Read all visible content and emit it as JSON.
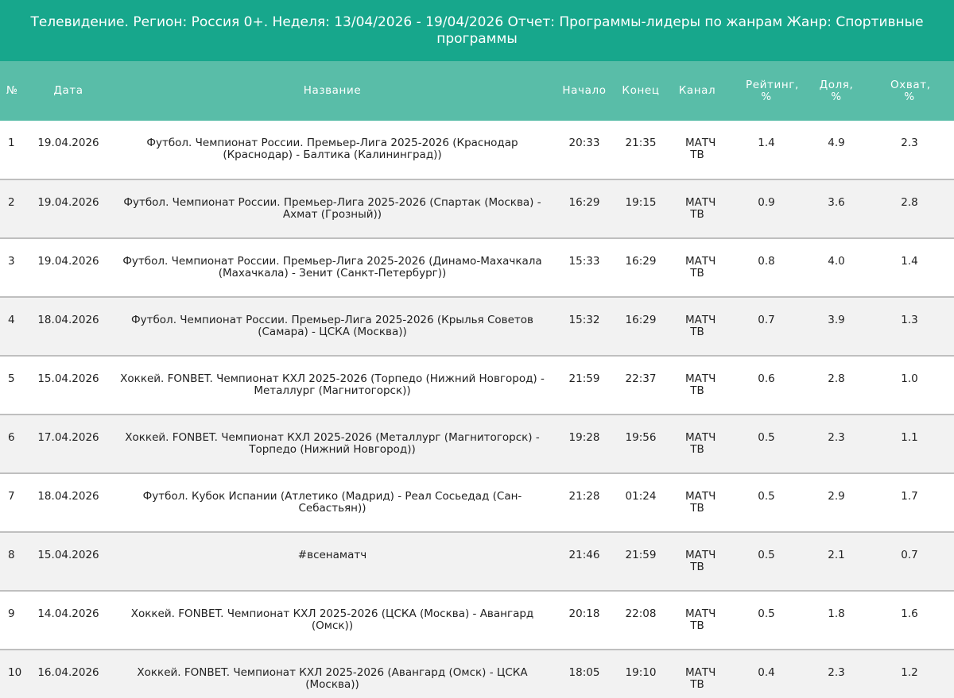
{
  "header": {
    "title": "Телевидение. Регион: Россия 0+. Неделя: 13/04/2026 - 19/04/2026 Отчет: Программы-лидеры по жанрам Жанр: Спортивные программы"
  },
  "table": {
    "columns": {
      "num": "№",
      "date": "Дата",
      "name": "Название",
      "start": "Начало",
      "end": "Конец",
      "channel": "Канал",
      "rating": "Рейтинг, %",
      "share": "Доля, %",
      "reach": "Охват, %"
    },
    "rows": [
      {
        "num": "1",
        "date": "19.04.2026",
        "name": "Футбол. Чемпионат России. Премьер-Лига 2025-2026 (Краснодар (Краснодар) - Балтика (Калининград))",
        "start": "20:33",
        "end": "21:35",
        "channel": "МАТЧ ТВ",
        "rating": "1.4",
        "share": "4.9",
        "reach": "2.3"
      },
      {
        "num": "2",
        "date": "19.04.2026",
        "name": "Футбол. Чемпионат России. Премьер-Лига 2025-2026 (Спартак (Москва) - Ахмат (Грозный))",
        "start": "16:29",
        "end": "19:15",
        "channel": "МАТЧ ТВ",
        "rating": "0.9",
        "share": "3.6",
        "reach": "2.8"
      },
      {
        "num": "3",
        "date": "19.04.2026",
        "name": "Футбол. Чемпионат России. Премьер-Лига 2025-2026 (Динамо-Махачкала (Махачкала) - Зенит (Санкт-Петербург))",
        "start": "15:33",
        "end": "16:29",
        "channel": "МАТЧ ТВ",
        "rating": "0.8",
        "share": "4.0",
        "reach": "1.4"
      },
      {
        "num": "4",
        "date": "18.04.2026",
        "name": "Футбол. Чемпионат России. Премьер-Лига 2025-2026 (Крылья Советов (Самара) - ЦСКА (Москва))",
        "start": "15:32",
        "end": "16:29",
        "channel": "МАТЧ ТВ",
        "rating": "0.7",
        "share": "3.9",
        "reach": "1.3"
      },
      {
        "num": "5",
        "date": "15.04.2026",
        "name": "Хоккей. FONBET. Чемпионат КХЛ 2025-2026 (Торпедо (Нижний Новгород) - Металлург (Магнитогорск))",
        "start": "21:59",
        "end": "22:37",
        "channel": "МАТЧ ТВ",
        "rating": "0.6",
        "share": "2.8",
        "reach": "1.0"
      },
      {
        "num": "6",
        "date": "17.04.2026",
        "name": "Хоккей. FONBET. Чемпионат КХЛ 2025-2026 (Металлург (Магнитогорск) - Торпедо (Нижний Новгород))",
        "start": "19:28",
        "end": "19:56",
        "channel": "МАТЧ ТВ",
        "rating": "0.5",
        "share": "2.3",
        "reach": "1.1"
      },
      {
        "num": "7",
        "date": "18.04.2026",
        "name": "Футбол. Кубок Испании (Атлетико (Мадрид) - Реал Сосьедад (Сан-Себастьян))",
        "start": "21:28",
        "end": "01:24",
        "channel": "МАТЧ ТВ",
        "rating": "0.5",
        "share": "2.9",
        "reach": "1.7"
      },
      {
        "num": "8",
        "date": "15.04.2026",
        "name": "#всенаматч",
        "start": "21:46",
        "end": "21:59",
        "channel": "МАТЧ ТВ",
        "rating": "0.5",
        "share": "2.1",
        "reach": "0.7"
      },
      {
        "num": "9",
        "date": "14.04.2026",
        "name": "Хоккей. FONBET. Чемпионат КХЛ 2025-2026 (ЦСКА (Москва) - Авангард (Омск))",
        "start": "20:18",
        "end": "22:08",
        "channel": "МАТЧ ТВ",
        "rating": "0.5",
        "share": "1.8",
        "reach": "1.6"
      },
      {
        "num": "10",
        "date": "16.04.2026",
        "name": "Хоккей. FONBET. Чемпионат КХЛ 2025-2026 (Авангард (Омск) - ЦСКА (Москва))",
        "start": "18:05",
        "end": "19:10",
        "channel": "МАТЧ ТВ",
        "rating": "0.4",
        "share": "2.3",
        "reach": "1.2"
      }
    ]
  },
  "colors": {
    "title_bg": "#17a78c",
    "header_bg": "#59bda8",
    "row_alt_bg": "#f2f2f2",
    "row_border": "#bfbfbf"
  }
}
